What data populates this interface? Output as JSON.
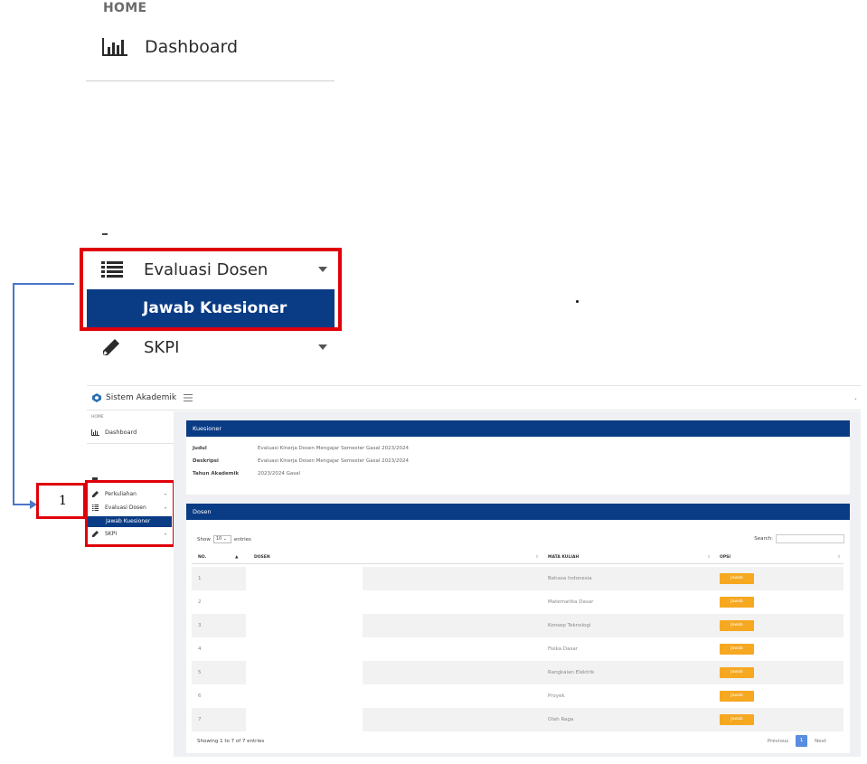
{
  "zoom": {
    "home_label": "HOME",
    "dashboard_label": "Dashboard",
    "evaluasi_label": "Evaluasi Dosen",
    "jawab_label": "Jawab Kuesioner",
    "skpi_label": "SKPI"
  },
  "callout": {
    "number": "1"
  },
  "colors": {
    "primary": "#0a3b85",
    "highlight": "#e0000a",
    "connector": "#4a76c8",
    "button": "#f6a821",
    "page_active": "#5a8de0"
  },
  "app": {
    "title": "Sistem Akademik",
    "sidebar": {
      "home_label": "HOME",
      "dashboard_label": "Dashboard",
      "items": [
        {
          "label": "Perkuliahan",
          "icon": "pencil-icon"
        },
        {
          "label": "Evaluasi Dosen",
          "icon": "list-icon"
        },
        {
          "label": "Jawab Kuesioner",
          "active": true
        },
        {
          "label": "SKPI",
          "icon": "pencil-icon"
        }
      ]
    },
    "kuesioner": {
      "header": "Kuesioner",
      "judul_label": "Judul",
      "judul_value": "Evaluasi Kinerja Dosen Mengajar Semester Gasal 2023/2024",
      "deskripsi_label": "Deskripsi",
      "deskripsi_value": "Evaluasi Kinerja Dosen Mengajar Semester Gasal 2023/2024",
      "tahun_label": "Tahun Akademik",
      "tahun_value": "2023/2024 Gasal"
    },
    "dosen": {
      "header": "Dosen",
      "show_label": "Show",
      "show_value": "10",
      "entries_label": "entries",
      "search_label": "Search:",
      "columns": [
        "NO.",
        "DOSEN",
        "MATA KULIAH",
        "OPSI"
      ],
      "rows": [
        {
          "no": "1",
          "mata_kuliah": "Bahasa Indonesia",
          "action": "Jawab"
        },
        {
          "no": "2",
          "mata_kuliah": "Matematika Dasar",
          "action": "Jawab"
        },
        {
          "no": "3",
          "mata_kuliah": "Konsep Teknologi",
          "action": "Jawab"
        },
        {
          "no": "4",
          "mata_kuliah": "Fisika Dasar",
          "action": "Jawab"
        },
        {
          "no": "5",
          "mata_kuliah": "Rangkaian Elektrik",
          "action": "Jawab"
        },
        {
          "no": "6",
          "mata_kuliah": "Proyek",
          "action": "Jawab"
        },
        {
          "no": "7",
          "mata_kuliah": "Olah Raga",
          "action": "Jawab"
        }
      ],
      "info": "Showing 1 to 7 of 7 entries",
      "previous_label": "Previous",
      "page_label": "1",
      "next_label": "Next"
    }
  }
}
